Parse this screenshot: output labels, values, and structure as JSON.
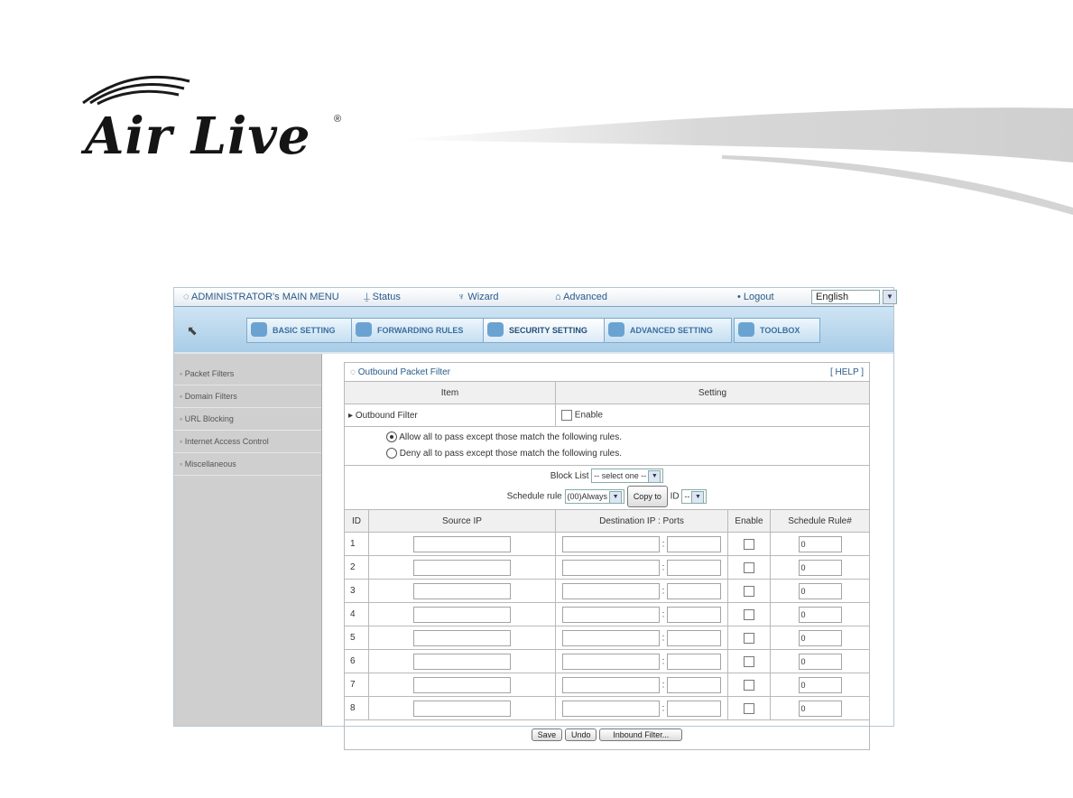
{
  "logo": {
    "text": "Air Live",
    "registered": "®"
  },
  "top_menu": {
    "admin": "ADMINISTRATOR's MAIN MENU",
    "status": "Status",
    "wizard": "Wizard",
    "advanced": "Advanced",
    "logout": "Logout",
    "language": "English"
  },
  "tabs": [
    {
      "label": "BASIC SETTING"
    },
    {
      "label": "FORWARDING RULES"
    },
    {
      "label": "SECURITY SETTING"
    },
    {
      "label": "ADVANCED SETTING"
    },
    {
      "label": "TOOLBOX"
    }
  ],
  "sidebar": {
    "items": [
      {
        "label": "Packet Filters"
      },
      {
        "label": "Domain Filters"
      },
      {
        "label": "URL Blocking"
      },
      {
        "label": "Internet Access Control"
      },
      {
        "label": "Miscellaneous"
      }
    ]
  },
  "panel": {
    "title": "Outbound Packet Filter",
    "help": "[ HELP ]",
    "col_item": "Item",
    "col_setting": "Setting",
    "outbound_filter_label": "Outbound Filter",
    "enable_label": "Enable",
    "radio_allow": "Allow all to pass except those match the following rules.",
    "radio_deny": "Deny all to pass except those match the following rules.",
    "block_list_label": "Block List",
    "block_list_value": "-- select one --",
    "schedule_rule_label": "Schedule rule",
    "schedule_rule_value": "(00)Always",
    "copy_to": "Copy to",
    "id_label": "ID",
    "id_value": "--",
    "table_headers": {
      "id": "ID",
      "source": "Source IP",
      "dest": "Destination IP : Ports",
      "enable": "Enable",
      "schedule": "Schedule Rule#"
    },
    "rows": [
      {
        "id": "1",
        "schedule": "0"
      },
      {
        "id": "2",
        "schedule": "0"
      },
      {
        "id": "3",
        "schedule": "0"
      },
      {
        "id": "4",
        "schedule": "0"
      },
      {
        "id": "5",
        "schedule": "0"
      },
      {
        "id": "6",
        "schedule": "0"
      },
      {
        "id": "7",
        "schedule": "0"
      },
      {
        "id": "8",
        "schedule": "0"
      }
    ],
    "buttons": {
      "save": "Save",
      "undo": "Undo",
      "inbound": "Inbound Filter..."
    }
  }
}
